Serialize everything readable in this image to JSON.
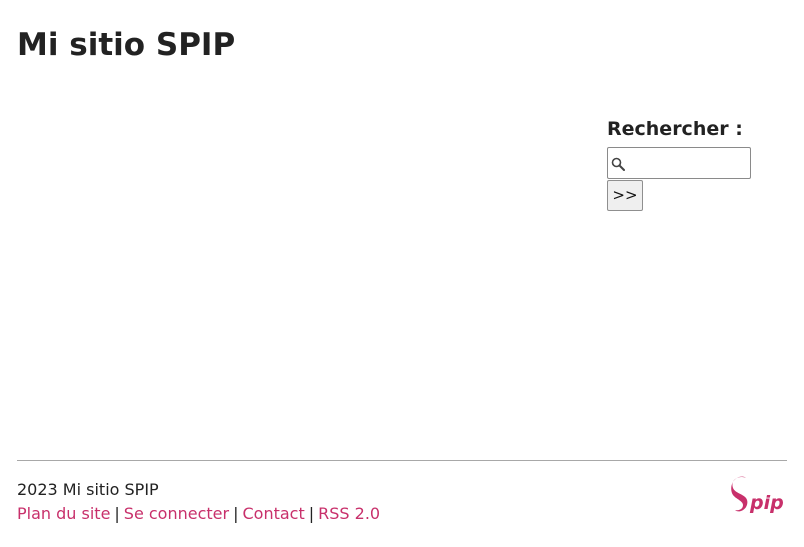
{
  "header": {
    "site_title": "Mi sitio SPIP"
  },
  "search": {
    "label": "Rechercher :",
    "value": "",
    "placeholder": "",
    "submit_label": ">>",
    "icon": "search-icon"
  },
  "footer": {
    "copyright": "2023 Mi sitio SPIP",
    "links": [
      {
        "label": "Plan du site"
      },
      {
        "label": "Se connecter"
      },
      {
        "label": "Contact"
      },
      {
        "label": "RSS 2.0"
      }
    ],
    "separator": "|",
    "logo_icon": "spip-logo-icon"
  },
  "colors": {
    "link": "#c8306b",
    "text": "#222222",
    "logo": "#c8306b"
  }
}
